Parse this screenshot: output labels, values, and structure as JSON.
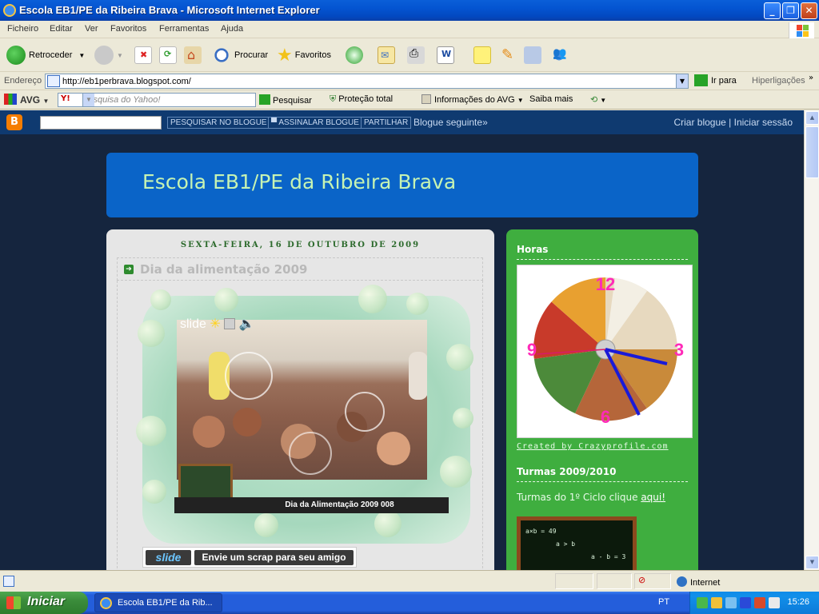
{
  "window": {
    "title": "Escola EB1/PE da Ribeira Brava - Microsoft Internet Explorer",
    "minimize": "_",
    "maximize": "❐",
    "close": "✕"
  },
  "menu": [
    "Ficheiro",
    "Editar",
    "Ver",
    "Favoritos",
    "Ferramentas",
    "Ajuda"
  ],
  "toolbar": {
    "back": "Retroceder",
    "search": "Procurar",
    "favorites": "Favoritos"
  },
  "address": {
    "label": "Endereço",
    "url": "http://eb1perbrava.blogspot.com/",
    "go": "Ir para",
    "links": "Hiperligações"
  },
  "avgbar": {
    "brand": "AVG",
    "yahoo_logo": "Y!",
    "search_placeholder": "Pesquisa do Yahoo!",
    "search_btn": "Pesquisar",
    "protection": "Proteção total",
    "info": "Informações do AVG",
    "more": "Saiba mais"
  },
  "navbar": {
    "search_btn": "PESQUISAR NO BLOGUE",
    "flag_btn": "ASSINALAR BLOGUE",
    "share_btn": "PARTILHAR",
    "next_blog": "Blogue seguinte»",
    "create_blog": "Criar blogue",
    "separator": "|",
    "sign_in": "Iniciar sessão"
  },
  "blog": {
    "title": "Escola EB1/PE da Ribeira Brava",
    "post_date": "SEXTA-FEIRA, 16 DE OUTUBRO DE 2009",
    "post_title": "Dia da alimentação 2009",
    "slide_brand": "slide",
    "slide_caption": "Dia da Alimentação 2009 008",
    "scrap_logo": "slide",
    "scrap_btn": "Envie um scrap para seu amigo"
  },
  "sidebar": {
    "clock_heading": "Horas",
    "clock_numbers": [
      "12",
      "3",
      "6",
      "9"
    ],
    "created_by": "Created by Crazyprofile.com",
    "classes_heading": "Turmas 2009/2010",
    "classes_text": "Turmas do 1º Ciclo clique ",
    "classes_link": "aqui!",
    "chalk_lines": [
      "a×b = 49",
      "a > b",
      "a - b = 3"
    ]
  },
  "status": {
    "zone": "Internet"
  },
  "taskbar": {
    "start": "Iniciar",
    "task": "Escola EB1/PE da Rib...",
    "lang": "PT",
    "time": "15:26"
  }
}
